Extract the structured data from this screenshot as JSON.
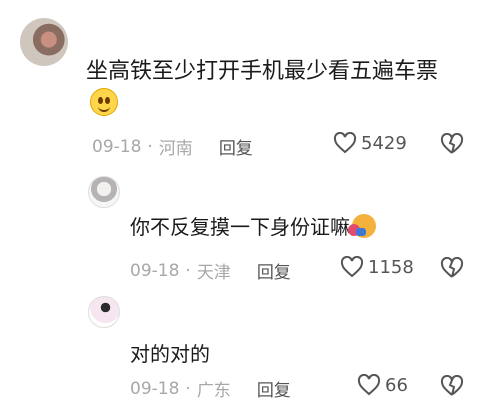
{
  "main_comment": {
    "text": "坐高铁至少打开手机最少看五遍车票",
    "date": "09-18",
    "location": "河南",
    "reply_label": "回复",
    "likes": "5429"
  },
  "replies": [
    {
      "text": "你不反复摸一下身份证嘛",
      "date": "09-18",
      "location": "天津",
      "reply_label": "回复",
      "likes": "1158"
    },
    {
      "text": "对的对的",
      "date": "09-18",
      "location": "广东",
      "reply_label": "回复",
      "likes": "66"
    }
  ],
  "separator": "·"
}
